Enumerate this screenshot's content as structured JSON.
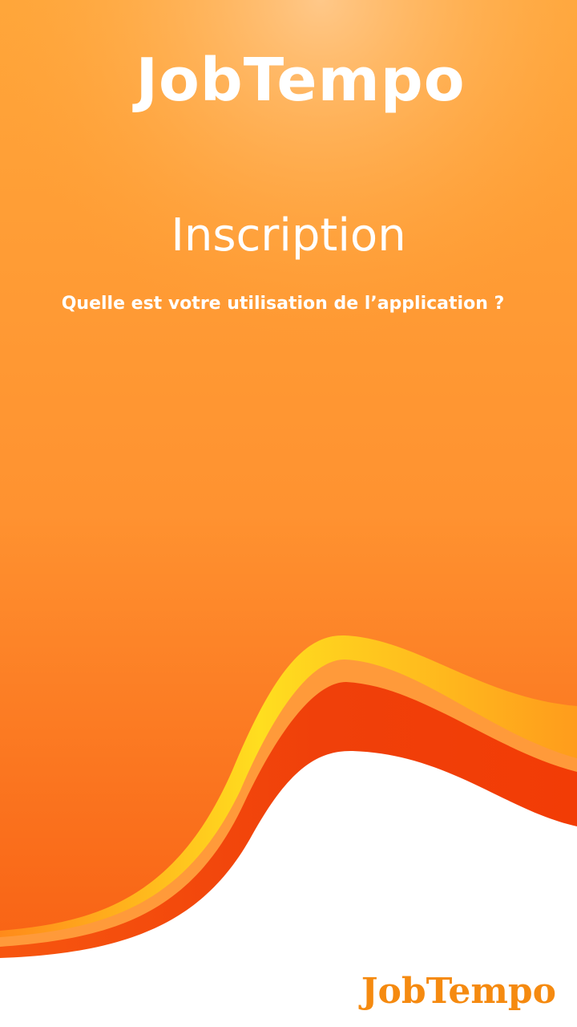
{
  "app": {
    "title": "JobTempo"
  },
  "signup": {
    "title": "Inscription",
    "question": "Quelle est votre utilisation de l’application ?"
  },
  "footer": {
    "logo_text": "JobTempo"
  },
  "colors": {
    "orange_top": "#ffa63a",
    "orange_bottom": "#f75a10",
    "wave_yellow": "#ffd21a",
    "wave_light_orange": "#ff9a3a",
    "wave_red_orange": "#f23c05",
    "brand_orange": "#f58a10",
    "text_white": "#ffffff"
  }
}
